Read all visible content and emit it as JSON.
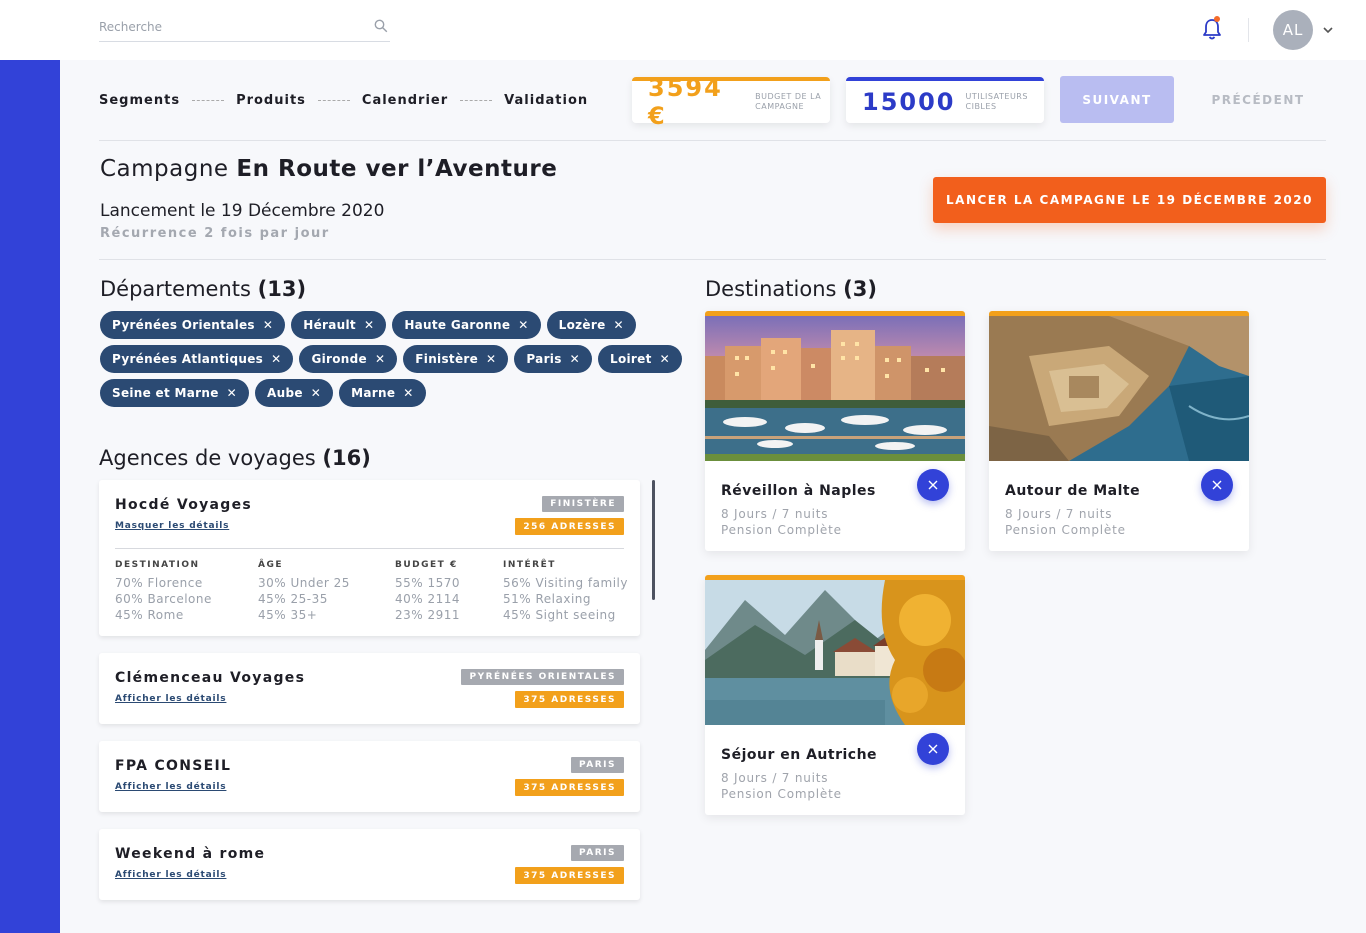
{
  "search": {
    "placeholder": "Recherche"
  },
  "user": {
    "initials": "AL"
  },
  "steps": [
    "Segments",
    "Produits",
    "Calendrier",
    "Validation"
  ],
  "kpis": {
    "budget": {
      "value": "3594 €",
      "label": "BUDGET DE LA CAMPAGNE"
    },
    "users": {
      "value": "15000",
      "label": "UTILISATEURS CIBLES"
    }
  },
  "nav": {
    "next": "SUIVANT",
    "prev": "PRÉCÉDENT"
  },
  "campaign": {
    "title_prefix": "Campagne",
    "title_name": "En Route ver l’Aventure",
    "launch": "Lancement le 19 Décembre 2020",
    "recurrence": "Récurrence 2 fois par jour",
    "launch_button": "LANCER LA CAMPAGNE LE 19 DÉCEMBRE 2020"
  },
  "departments": {
    "title": "Départements",
    "count": "(13)",
    "rows": [
      [
        "Pyrénées Orientales",
        "Hérault",
        "Haute Garonne",
        "Lozère"
      ],
      [
        "Pyrénées Atlantiques",
        "Gironde",
        "Finistère",
        "Paris",
        "Loiret"
      ],
      [
        "Seine et Marne",
        "Aube",
        "Marne"
      ]
    ]
  },
  "agencies": {
    "title": "Agences de voyages",
    "count": "(16)",
    "items": [
      {
        "name": "Hocdé Voyages",
        "link": "Masquer les détails",
        "region": "FINISTÈRE",
        "count": "256 ADRESSES",
        "details": [
          {
            "header": "DESTINATION",
            "values": [
              "70% Florence",
              "60% Barcelone",
              "45% Rome"
            ]
          },
          {
            "header": "ÂGE",
            "values": [
              "30% Under 25",
              "45% 25-35",
              "45% 35+"
            ]
          },
          {
            "header": "BUDGET €",
            "values": [
              "55% 1570",
              "40% 2114",
              "23% 2911"
            ]
          },
          {
            "header": "INTÉRÊT",
            "values": [
              "56% Visiting family",
              "51% Relaxing",
              "45% Sight seeing"
            ]
          }
        ]
      },
      {
        "name": "Clémenceau Voyages",
        "link": "Afficher les détails",
        "region": "PYRÉNÉES ORIENTALES",
        "count": "375 ADRESSES"
      },
      {
        "name": "FPA CONSEIL",
        "link": "Afficher les détails",
        "region": "PARIS",
        "count": "375 ADRESSES"
      },
      {
        "name": "Weekend à rome",
        "link": "Afficher les détails",
        "region": "PARIS",
        "count": "375 ADRESSES"
      }
    ]
  },
  "destinations": {
    "title": "Destinations",
    "count": "(3)",
    "items": [
      {
        "title": "Réveillon à Naples",
        "duration": "8 Jours / 7 nuits",
        "board": "Pension Complète"
      },
      {
        "title": "Autour de Malte",
        "duration": "8 Jours / 7 nuits",
        "board": "Pension Complète"
      },
      {
        "title": "Séjour en Autriche",
        "duration": "8 Jours / 7 nuits",
        "board": "Pension Complète"
      }
    ]
  },
  "colors": {
    "accent_blue": "#3242d8",
    "accent_orange": "#f25f1c",
    "accent_yellow": "#f2a01b",
    "chip_navy": "#2b4a73"
  },
  "icons": [
    "search-icon",
    "bell-icon",
    "chevron-down-icon",
    "close-icon"
  ]
}
